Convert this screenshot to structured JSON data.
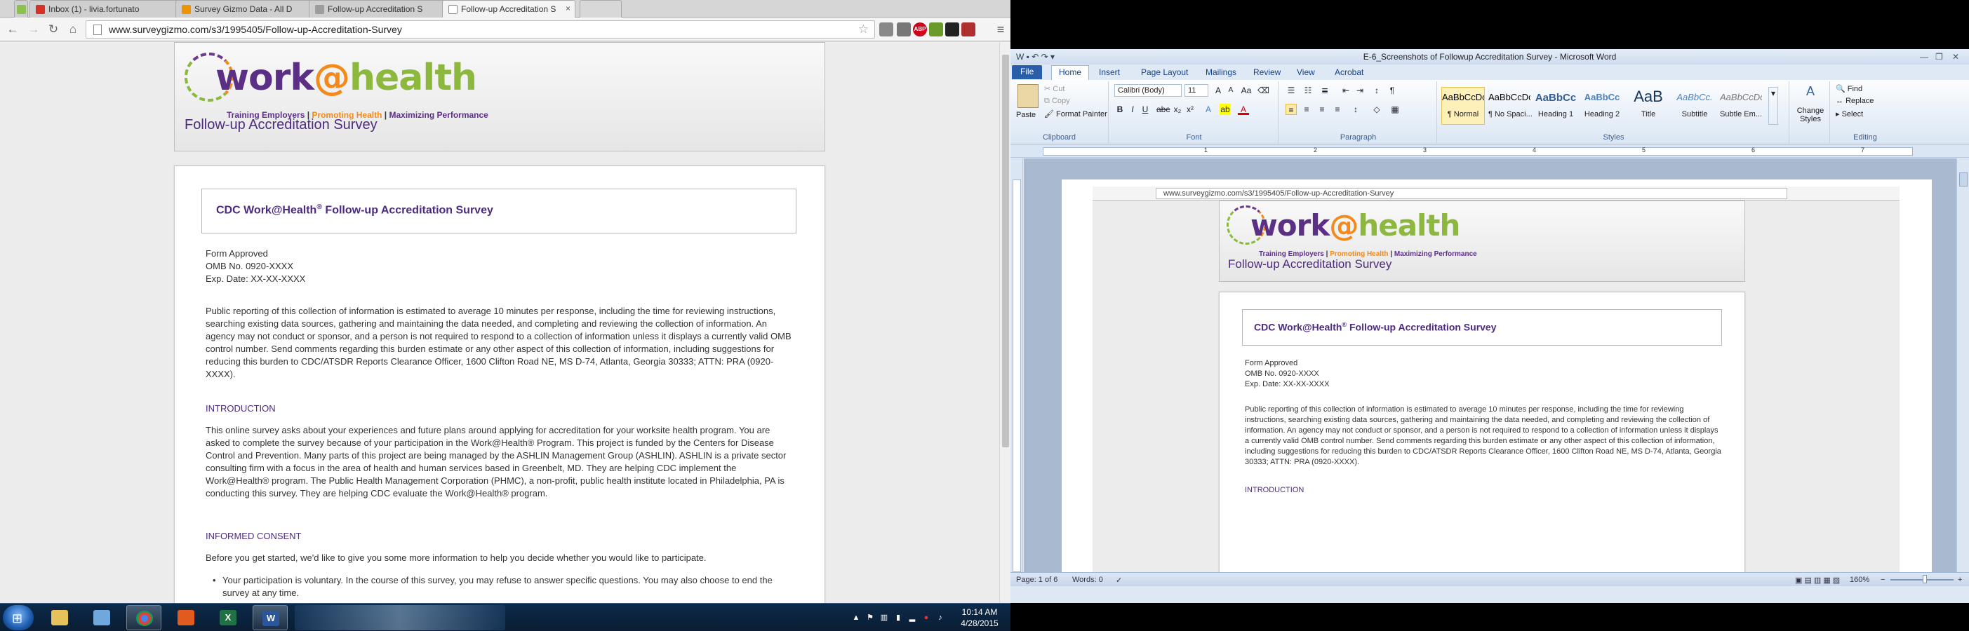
{
  "chrome": {
    "tabs": [
      {
        "label": "Inbox (1) - livia.fortunato",
        "fav_color": "#d93025"
      },
      {
        "label": "Survey Gizmo Data - All D",
        "fav_color": "#f09300"
      },
      {
        "label": "Follow-up Accreditation S",
        "fav_color": "#9d9d9d"
      },
      {
        "label": "Follow-up Accreditation S",
        "fav_color": "#ffffff"
      }
    ],
    "close_glyph": "×",
    "url": "www.surveygizmo.com/s3/1995405/Follow-up-Accreditation-Survey",
    "nav": {
      "back": "←",
      "forward": "→",
      "reload": "↻",
      "home": "⌂"
    },
    "ext_labels": {
      "adblock": "ABP",
      "menu": "≡"
    }
  },
  "survey": {
    "logo": {
      "work": "work",
      "at": "@",
      "health": "health",
      "tag1": "Training Employers",
      "tag2": "Promoting Health",
      "tag3": "Maximizing Performance",
      "sep": "|"
    },
    "subtitle": "Follow-up Accreditation Survey",
    "title_main": "CDC Work@Health",
    "title_reg": "®",
    "title_rest": " Follow-up Accreditation Survey",
    "form_approved": "Form Approved",
    "omb": "OMB No. 0920-XXXX",
    "exp": "Exp. Date: XX-XX-XXXX",
    "burden": "Public reporting of this collection of information is estimated to average 10 minutes per response, including the time for reviewing instructions, searching existing data sources, gathering and maintaining the data needed, and completing and reviewing the collection of information.  An agency may not conduct or sponsor, and a person is not required to respond to a collection of information unless it displays a currently valid OMB control number.  Send comments regarding this burden estimate or any other aspect of this collection of information, including suggestions for reducing this burden to CDC/ATSDR Reports Clearance Officer, 1600 Clifton Road NE, MS D-74, Atlanta, Georgia 30333; ATTN: PRA (0920-XXXX).",
    "intro_head": "INTRODUCTION",
    "intro": "This online survey asks about your experiences and future plans around applying for accreditation for your worksite health program. You are asked to complete the survey because of your participation in the Work@Health® Program.  This project is funded by the Centers for Disease Control and Prevention. Many parts of this project are being managed by the ASHLIN Management Group (ASHLIN). ASHLIN is a private sector consulting firm with a focus in the area of health and human services based in Greenbelt, MD. They are helping CDC implement the Work@Health® program.  The Public Health Management Corporation (PHMC), a non-profit, public health institute located in Philadelphia, PA is conducting this survey.  They are helping CDC evaluate the Work@Health® program.",
    "consent_head": "INFORMED CONSENT",
    "consent": "Before you get started, we'd like to give you some more information to help you decide whether you would like to participate.",
    "bullet1": "Your participation is voluntary.  In the course of this survey, you may refuse to answer specific questions. You may also choose to end the survey at any time."
  },
  "word": {
    "title": "E-6_Screenshots of Followup Accreditation Survey  -  Microsoft Word",
    "tabs": [
      "File",
      "Home",
      "Insert",
      "Page Layout",
      "Mailings",
      "Review",
      "View",
      "Acrobat"
    ],
    "clipboard": {
      "paste": "Paste",
      "cut": "Cut",
      "copy": "Copy",
      "painter": "Format Painter",
      "label": "Clipboard"
    },
    "font": {
      "name": "Calibri (Body)",
      "size": "11",
      "label": "Font"
    },
    "paragraph_label": "Paragraph",
    "styles_label": "Styles",
    "styles": [
      {
        "preview": "AaBbCcDc",
        "name": "¶ Normal"
      },
      {
        "preview": "AaBbCcDc",
        "name": "¶ No Spaci..."
      },
      {
        "preview": "AaBbCc",
        "name": "Heading 1"
      },
      {
        "preview": "AaBbCc",
        "name": "Heading 2"
      },
      {
        "preview": "AaB",
        "name": "Title"
      },
      {
        "preview": "AaBbCc.",
        "name": "Subtitle"
      },
      {
        "preview": "AaBbCcDc",
        "name": "Subtle Em..."
      }
    ],
    "change_styles": "Change Styles",
    "editing": {
      "find": "Find",
      "replace": "Replace",
      "select": "Select",
      "label": "Editing"
    },
    "ruler_nums": [
      "1",
      "2",
      "3",
      "4",
      "5",
      "6",
      "7"
    ],
    "status": {
      "page": "Page: 1 of 6",
      "words": "Words: 0",
      "zoom": "160%"
    }
  },
  "taskbar": {
    "time": "10:14 AM",
    "date": "4/28/2015"
  }
}
